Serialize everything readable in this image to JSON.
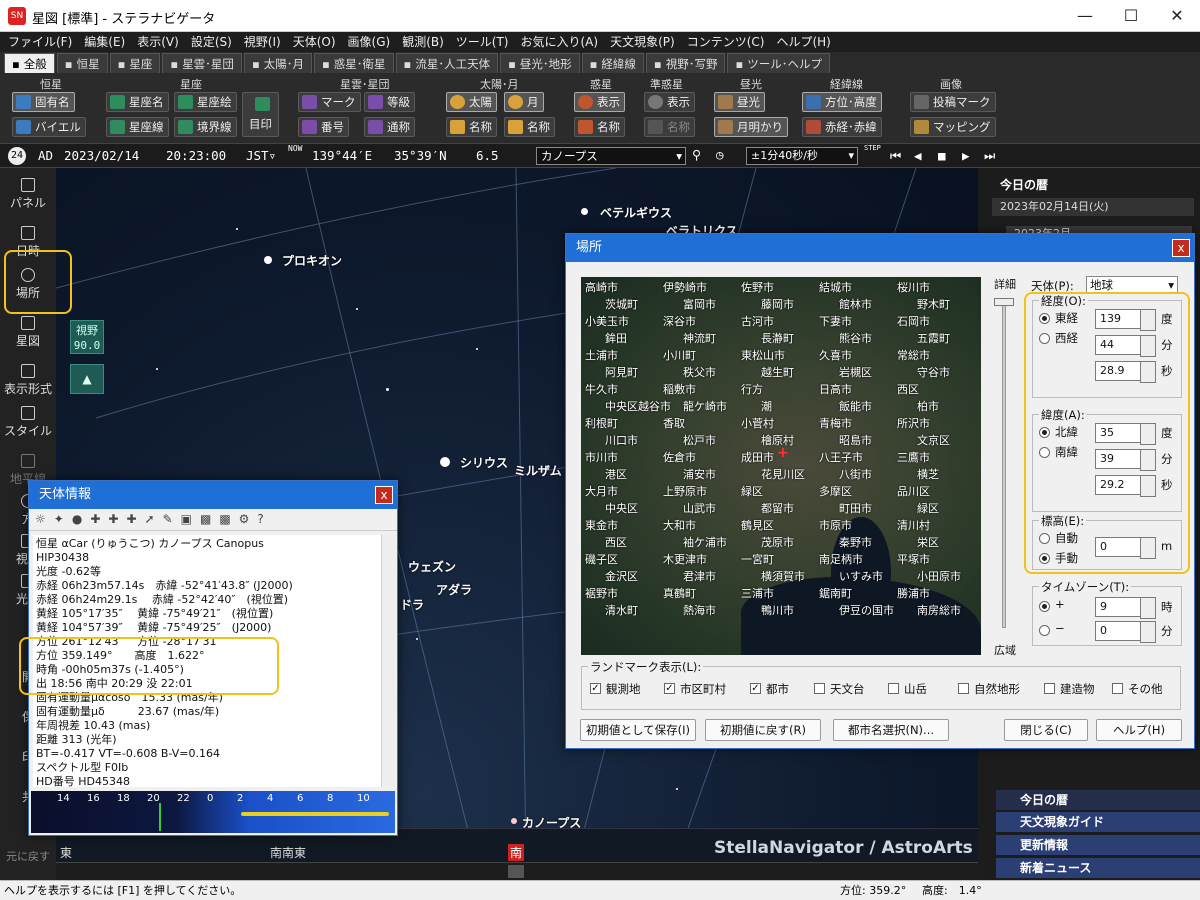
{
  "window": {
    "title": "星図 [標準] - ステラナビゲータ",
    "icon": "SN"
  },
  "menu": [
    "ファイル(F)",
    "編集(E)",
    "表示(V)",
    "設定(S)",
    "視野(I)",
    "天体(O)",
    "画像(G)",
    "観測(B)",
    "ツール(T)",
    "お気に入り(A)",
    "天文現象(P)",
    "コンテンツ(C)",
    "ヘルプ(H)"
  ],
  "tabs": [
    "全般",
    "恒星",
    "星座",
    "星雲･星団",
    "太陽･月",
    "惑星･衛星",
    "流星･人工天体",
    "昼光･地形",
    "経緯線",
    "視野･写野",
    "ツール･ヘルプ"
  ],
  "ribbon": {
    "groups": [
      "恒星",
      "星座",
      "星雲･星団",
      "太陽･月",
      "惑星",
      "準惑星",
      "昼光",
      "経緯線",
      "画像"
    ],
    "star": [
      "固有名",
      "バイエル"
    ],
    "constellation": [
      "星座名",
      "星座絵",
      "星座線",
      "境界線",
      "目印"
    ],
    "nebula": [
      "マーク",
      "等級",
      "番号",
      "通称"
    ],
    "sunmoon": [
      "太陽",
      "月",
      "名称",
      "名称"
    ],
    "planet": [
      "表示",
      "名称"
    ],
    "dwarf": [
      "表示",
      "名称"
    ],
    "daylight": [
      "昼光",
      "月明かり"
    ],
    "grid": [
      "方位･高度",
      "赤経･赤緯"
    ],
    "image": [
      "投稿マーク",
      "マッピング"
    ]
  },
  "status": {
    "era": "AD",
    "date": "2023/02/14",
    "time": "20:23:00",
    "tz": "JST▿",
    "now": "NOW",
    "lon": "139°44′E",
    "lat": "35°39′N",
    "mag": "6.5",
    "target": "カノープス",
    "step": "±1分40秒/秒",
    "step_label": "STEP"
  },
  "sidebar": [
    "パネル",
    "日時",
    "場所",
    "星図",
    "表示形式",
    "スタイル",
    "地平線",
    "方",
    "視野",
    "光跡",
    "開",
    "保",
    "印",
    "共",
    "元に戻す"
  ],
  "view": {
    "label": "視野",
    "value": "90.0"
  },
  "sky_labels": [
    "ベテルギウス",
    "ベラトリクス",
    "プロキオン",
    "シリウス",
    "ミルザム",
    "ウェズン",
    "アダラ",
    "ドラ",
    "カノープス"
  ],
  "horizon": [
    "東",
    "南南東",
    "南"
  ],
  "watermark": "StellaNavigator / AstroArts",
  "statusbar": {
    "help": "ヘルプを表示するには [F1] を押してください。",
    "az": "方位: 359.2°",
    "alt": "高度:　1.4°"
  },
  "right_panel": {
    "title": "今日の暦",
    "date": "2023年02月14日(火)",
    "partial": "2023年2月",
    "items": [
      "今日の暦",
      "天文現象ガイド",
      "更新情報",
      "新着ニュース"
    ]
  },
  "info_dialog": {
    "title": "天体情報",
    "lines": [
      "恒星 αCar (りゅうこつ) カノープス Canopus",
      "HIP30438",
      "光度 -0.62等",
      "赤経 06h23m57.14s　赤緯 -52°41′43.8″ (J2000)",
      "赤経 06h24m29.1s　 赤緯 -52°42′40″　(視位置)",
      "黄経 105°17′35″　 黄緯 -75°49′21″　(視位置)",
      "黄経 104°57′39″　 黄緯 -75°49′25″　(J2000)",
      "方位 261°12′43″　 方位 -28°17′31″",
      "方位 359.149°　　高度　1.622°",
      "時角 -00h05m37s (-1.405°)",
      "出 18:56 南中 20:29 没 22:01",
      "固有運動量μαcosδ　15.33 (mas/年)",
      "固有運動量μδ　　　23.67 (mas/年)",
      "年周視差 10.43 (mas)",
      "距離 313 (光年)",
      "BT=-0.417 VT=-0.608 B-V=0.164",
      "スペクトル型 F0Ib",
      "HD番号 HD45348"
    ],
    "timeline": [
      "14",
      "16",
      "18",
      "20",
      "22",
      "0",
      "2",
      "4",
      "6",
      "8",
      "10"
    ]
  },
  "loc_dialog": {
    "title": "場所",
    "detail": "詳細",
    "wide": "広域",
    "body_label": "天体(P):",
    "body": "地球",
    "lon_title": "経度(O):",
    "east": "東経",
    "west": "西経",
    "lon": [
      "139",
      "44",
      "28.9"
    ],
    "deg": "度",
    "min": "分",
    "sec": "秒",
    "lat_title": "緯度(A):",
    "north": "北緯",
    "south": "南緯",
    "lat": [
      "35",
      "39",
      "29.2"
    ],
    "alt_title": "標高(E):",
    "auto": "自動",
    "manual": "手動",
    "alt": "0",
    "m": "m",
    "tz_title": "タイムゾーン(T):",
    "plus": "+",
    "minus": "−",
    "tz": [
      "9",
      "0"
    ],
    "hour": "時",
    "landmark_title": "ランドマーク表示(L):",
    "landmarks": [
      {
        "label": "観測地",
        "on": true
      },
      {
        "label": "市区町村",
        "on": true
      },
      {
        "label": "都市",
        "on": true
      },
      {
        "label": "天文台",
        "on": false
      },
      {
        "label": "山岳",
        "on": false
      },
      {
        "label": "自然地形",
        "on": false
      },
      {
        "label": "建造物",
        "on": false
      },
      {
        "label": "その他",
        "on": false
      }
    ],
    "buttons": [
      "初期値として保存(I)",
      "初期値に戻す(R)",
      "都市名選択(N)...",
      "閉じる(C)",
      "ヘルプ(H)"
    ],
    "cities": [
      "高崎市",
      "伊勢崎市",
      "佐野市",
      "結城市",
      "桜川市",
      "茨城町",
      "富岡市",
      "藤岡市",
      "館林市",
      "野木町",
      "小美玉市",
      "深谷市",
      "古河市",
      "下妻市",
      "石岡市",
      "鉾田",
      "神流町",
      "長瀞町",
      "熊谷市",
      "五霞町",
      "土浦市",
      "小川町",
      "東松山市",
      "久喜市",
      "常総市",
      "阿見町",
      "秩父市",
      "越生町",
      "岩槻区",
      "守谷市",
      "牛久市",
      "稲敷市",
      "行方",
      "日高市",
      "西区",
      "中央区越谷市",
      "龍ケ崎市",
      "潮",
      "飯能市",
      "柏市",
      "利根町",
      "香取",
      "小菅村",
      "青梅市",
      "所沢市",
      "川口市",
      "松戸市",
      "檜原村",
      "昭島市",
      "文京区",
      "市川市",
      "佐倉市",
      "成田市",
      "八王子市",
      "三鷹市",
      "港区",
      "浦安市",
      "花見川区",
      "八街市",
      "横芝",
      "大月市",
      "上野原市",
      "緑区",
      "多摩区",
      "品川区",
      "中央区",
      "山武市",
      "都留市",
      "町田市",
      "緑区",
      "東金市",
      "大和市",
      "鶴見区",
      "市原市",
      "清川村",
      "西区",
      "袖ケ浦市",
      "茂原市",
      "秦野市",
      "栄区",
      "磯子区",
      "木更津市",
      "一宮町",
      "南足柄市",
      "平塚市",
      "金沢区",
      "君津市",
      "横須賀市",
      "いすみ市",
      "小田原市",
      "裾野市",
      "真鶴町",
      "三浦市",
      "鋸南町",
      "勝浦市",
      "清水町",
      "熱海市",
      "鴨川市",
      "伊豆の国市",
      "南房総市"
    ]
  }
}
